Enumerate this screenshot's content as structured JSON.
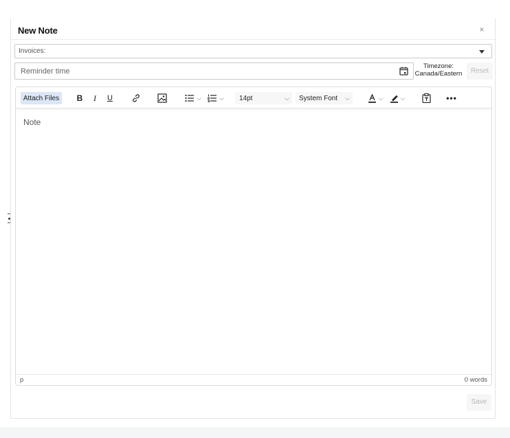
{
  "dialog": {
    "title": "New Note",
    "close_glyph": "×",
    "close_icon": "close-icon"
  },
  "invoices": {
    "label": "Invoices:",
    "caret_icon": "caret-down-icon"
  },
  "reminder": {
    "placeholder": "Reminder time",
    "value": "",
    "calendar_icon": "calendar-icon"
  },
  "timezone": {
    "label": "Timezone:",
    "value": "Canada/Eastern"
  },
  "reset_label": "Reset",
  "toolbar": {
    "attach_label": "Attach Files",
    "bold_label": "B",
    "italic_label": "I",
    "underline_label": "U",
    "font_size": "14pt",
    "font_family": "System Font",
    "chevron_glyph": "⌵",
    "more_glyph": "•••",
    "icons": [
      "link-icon",
      "image-icon",
      "bullet-list-icon",
      "numbered-list-icon",
      "text-color-icon",
      "highlight-color-icon",
      "paste-text-icon",
      "more-icon"
    ]
  },
  "editor": {
    "placeholder": "Note",
    "path": "p",
    "word_count": "0 words"
  },
  "save_label": "Save",
  "colors": {
    "attach_bg": "#dbe6f6",
    "disabled_text": "#b5b5b5"
  }
}
